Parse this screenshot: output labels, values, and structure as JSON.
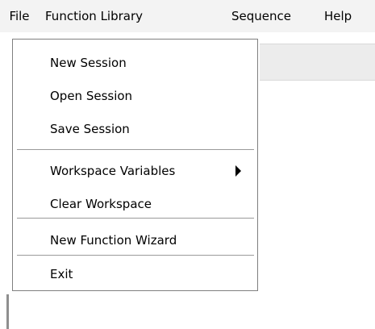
{
  "menubar": {
    "items": [
      {
        "label": "File"
      },
      {
        "label": "Function Library"
      },
      {
        "label": "Sequence"
      },
      {
        "label": "Help"
      }
    ]
  },
  "file_menu": {
    "items": [
      {
        "label": "New Session"
      },
      {
        "label": "Open Session"
      },
      {
        "label": "Save Session"
      },
      {
        "label": "Workspace Variables",
        "has_submenu": true
      },
      {
        "label": "Clear Workspace"
      },
      {
        "label": "New Function Wizard"
      },
      {
        "label": "Exit"
      }
    ]
  }
}
